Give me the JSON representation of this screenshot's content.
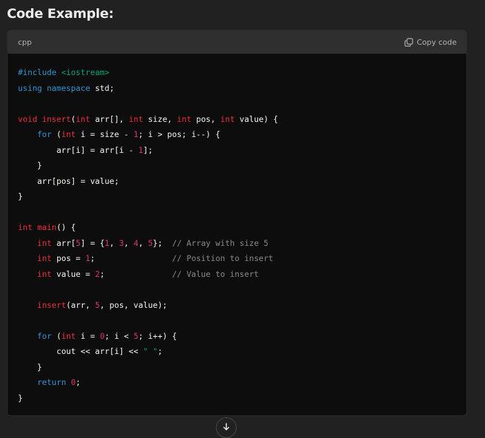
{
  "heading": "Code Example:",
  "code_block": {
    "language": "cpp",
    "copy_label": "Copy code",
    "lines": [
      [
        {
          "t": "#include ",
          "c": "kw-blue"
        },
        {
          "t": "<iostream>",
          "c": "inc"
        }
      ],
      [
        {
          "t": "using",
          "c": "kw-blue"
        },
        {
          "t": " "
        },
        {
          "t": "namespace",
          "c": "kw-blue"
        },
        {
          "t": " std;"
        }
      ],
      [],
      [
        {
          "t": "void",
          "c": "type-pink"
        },
        {
          "t": " "
        },
        {
          "t": "insert",
          "c": "fn-pink"
        },
        {
          "t": "("
        },
        {
          "t": "int",
          "c": "type-pink"
        },
        {
          "t": " arr[], "
        },
        {
          "t": "int",
          "c": "type-pink"
        },
        {
          "t": " size, "
        },
        {
          "t": "int",
          "c": "type-pink"
        },
        {
          "t": " pos, "
        },
        {
          "t": "int",
          "c": "type-pink"
        },
        {
          "t": " value) {"
        }
      ],
      [
        {
          "t": "    "
        },
        {
          "t": "for",
          "c": "kw-blue"
        },
        {
          "t": " ("
        },
        {
          "t": "int",
          "c": "type-pink"
        },
        {
          "t": " i = size - "
        },
        {
          "t": "1",
          "c": "num"
        },
        {
          "t": "; i > pos; i--) {"
        }
      ],
      [
        {
          "t": "        arr[i] = arr[i - "
        },
        {
          "t": "1",
          "c": "num"
        },
        {
          "t": "];"
        }
      ],
      [
        {
          "t": "    }"
        }
      ],
      [
        {
          "t": "    arr[pos] = value;"
        }
      ],
      [
        {
          "t": "}"
        }
      ],
      [],
      [
        {
          "t": "int",
          "c": "type-pink"
        },
        {
          "t": " "
        },
        {
          "t": "main",
          "c": "fn-pink"
        },
        {
          "t": "() {"
        }
      ],
      [
        {
          "t": "    "
        },
        {
          "t": "int",
          "c": "type-pink"
        },
        {
          "t": " arr["
        },
        {
          "t": "5",
          "c": "num"
        },
        {
          "t": "] = {"
        },
        {
          "t": "1",
          "c": "num"
        },
        {
          "t": ", "
        },
        {
          "t": "3",
          "c": "num"
        },
        {
          "t": ", "
        },
        {
          "t": "4",
          "c": "num"
        },
        {
          "t": ", "
        },
        {
          "t": "5",
          "c": "num"
        },
        {
          "t": "};  "
        },
        {
          "t": "// Array with size 5",
          "c": "cmt"
        }
      ],
      [
        {
          "t": "    "
        },
        {
          "t": "int",
          "c": "type-pink"
        },
        {
          "t": " pos = "
        },
        {
          "t": "1",
          "c": "num"
        },
        {
          "t": ";                "
        },
        {
          "t": "// Position to insert",
          "c": "cmt"
        }
      ],
      [
        {
          "t": "    "
        },
        {
          "t": "int",
          "c": "type-pink"
        },
        {
          "t": " value = "
        },
        {
          "t": "2",
          "c": "num"
        },
        {
          "t": ";              "
        },
        {
          "t": "// Value to insert",
          "c": "cmt"
        }
      ],
      [],
      [
        {
          "t": "    "
        },
        {
          "t": "insert",
          "c": "fn-pink"
        },
        {
          "t": "(arr, "
        },
        {
          "t": "5",
          "c": "num"
        },
        {
          "t": ", pos, value);"
        }
      ],
      [],
      [
        {
          "t": "    "
        },
        {
          "t": "for",
          "c": "kw-blue"
        },
        {
          "t": " ("
        },
        {
          "t": "int",
          "c": "type-pink"
        },
        {
          "t": " i = "
        },
        {
          "t": "0",
          "c": "num"
        },
        {
          "t": "; i < "
        },
        {
          "t": "5",
          "c": "num"
        },
        {
          "t": "; i++) {"
        }
      ],
      [
        {
          "t": "        cout << arr[i] << "
        },
        {
          "t": "\" \"",
          "c": "str"
        },
        {
          "t": ";"
        }
      ],
      [
        {
          "t": "    }"
        }
      ],
      [
        {
          "t": "    "
        },
        {
          "t": "return",
          "c": "kw-blue"
        },
        {
          "t": " "
        },
        {
          "t": "0",
          "c": "num"
        },
        {
          "t": ";"
        }
      ],
      [
        {
          "t": "}"
        }
      ]
    ]
  },
  "icons": {
    "copy": "copy-icon",
    "scroll_down": "arrow-down-icon"
  }
}
